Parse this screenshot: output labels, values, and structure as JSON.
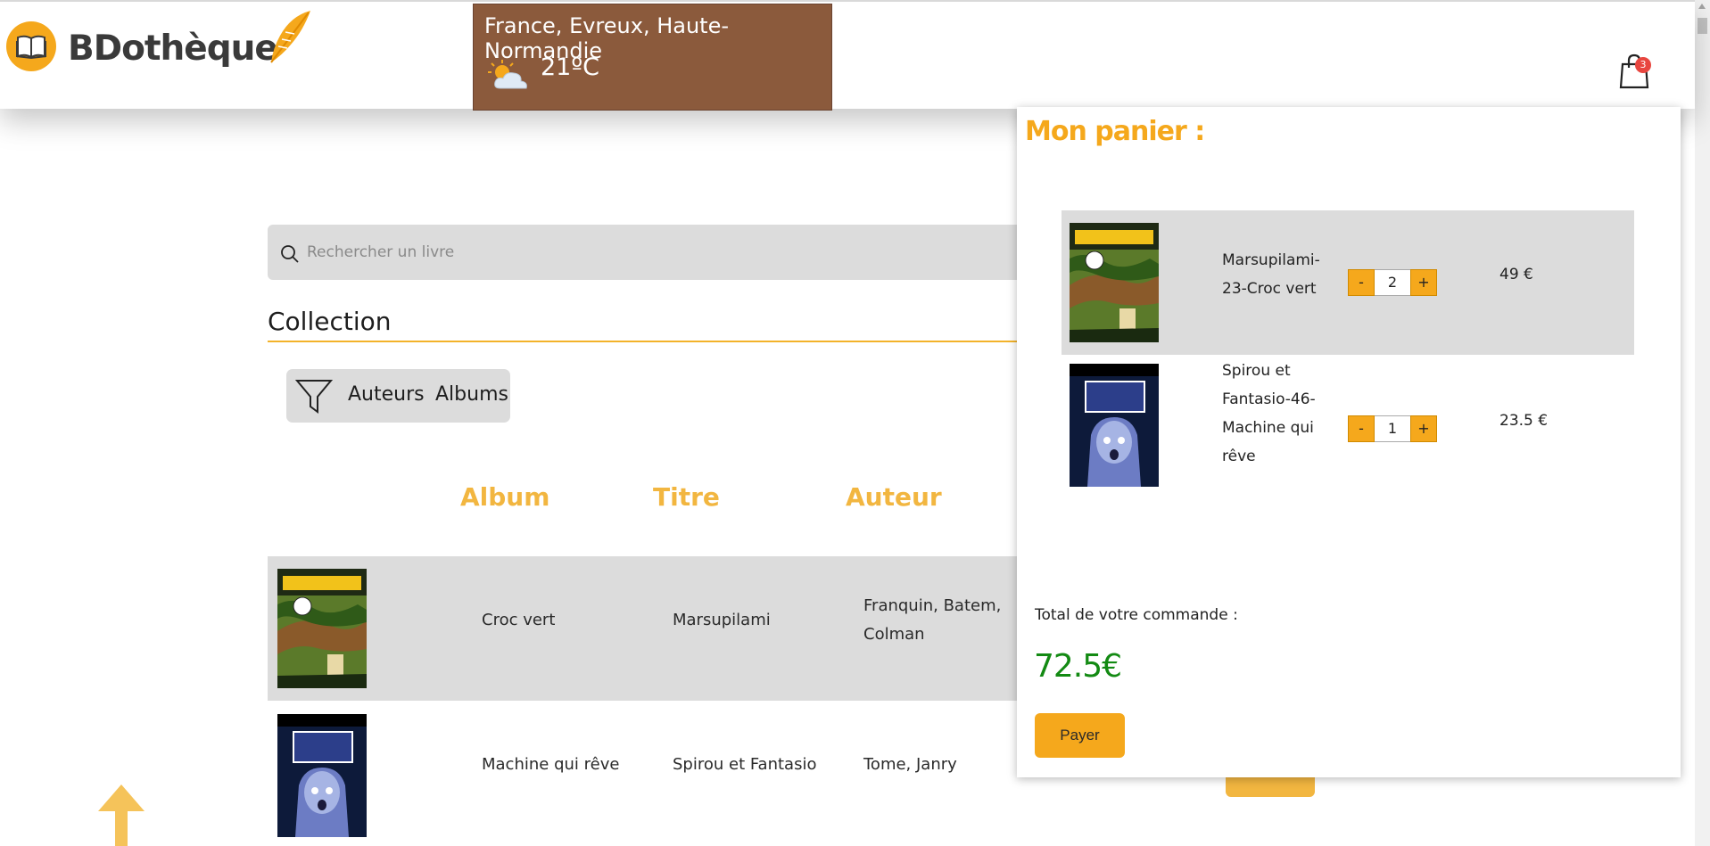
{
  "header": {
    "logo_title": "BDothèque",
    "weather": {
      "location": "France, Evreux, Haute-Normandie",
      "temperature": "21ºC",
      "icon": "sun-cloud-icon"
    },
    "cart": {
      "count": "3",
      "icon": "shopping-bag-icon"
    }
  },
  "search": {
    "placeholder": "Rechercher un livre"
  },
  "collection": {
    "title": "Collection",
    "filters": {
      "authors": "Auteurs",
      "albums": "Albums"
    },
    "columns": {
      "album": "Album",
      "title": "Titre",
      "author": "Auteur"
    },
    "rows": [
      {
        "album": "Croc vert",
        "title": "Marsupilami",
        "author": "Franquin, Batem, Colman"
      },
      {
        "album": "Machine qui rêve",
        "title": "Spirou et Fantasio",
        "author": "Tome, Janry"
      }
    ]
  },
  "cart_panel": {
    "title": "Mon panier :",
    "items": [
      {
        "name": "Marsupilami-23-Croc vert",
        "qty": "2",
        "price": "49 €",
        "minus": "-",
        "plus": "+"
      },
      {
        "name": "Spirou et Fantasio-46-Machine qui rêve",
        "qty": "1",
        "price": "23.5 €",
        "minus": "-",
        "plus": "+"
      }
    ],
    "total_label": "Total de votre commande :",
    "total_value": "72.5€",
    "pay_label": "Payer"
  },
  "colors": {
    "accent": "#f5a81c",
    "weather_bg": "#8b5a3c",
    "total": "#138a13",
    "column_head": "#f2b640"
  }
}
